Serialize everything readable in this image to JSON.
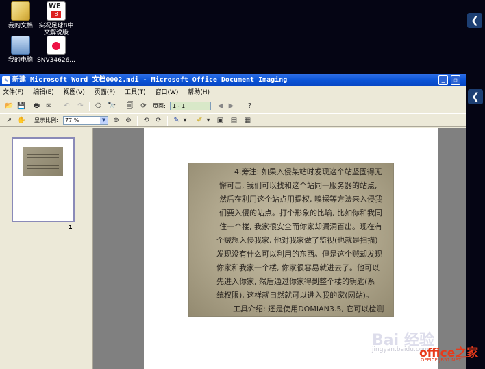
{
  "desktop": {
    "icons": [
      {
        "label": "我的文档",
        "label2": ""
      },
      {
        "label": "实况足球8中",
        "label2": "文解说版"
      },
      {
        "label": "我的电脑",
        "label2": ""
      },
      {
        "label": "SNV34626...",
        "label2": ""
      }
    ],
    "we_badge": "WE",
    "we_badge_num": "8",
    "swift_glyph": "❮"
  },
  "window": {
    "title": "新建 Microsoft Word 文档0002.mdi - Microsoft Office Document Imaging",
    "minimize_glyph": "_",
    "restore_glyph": "❐",
    "menu": [
      "文件(F)",
      "编辑(E)",
      "视图(V)",
      "页面(P)",
      "工具(T)",
      "窗口(W)",
      "帮助(H)"
    ],
    "toolbar1": {
      "page_label": "页面:",
      "page_value": "1 - 1"
    },
    "toolbar2": {
      "zoom_label": "显示比例:",
      "zoom_value": "77 %"
    },
    "thumbnail_page_number": "1"
  },
  "document": {
    "lines": [
      "4.旁注: 如果入侵某站时发现这个站坚固得无",
      "懈可击, 我们可以找和这个站同一服务器的站点,",
      "然后在利用这个站点用提权, 嗅探等方法来入侵我",
      "们要入侵的站点。打个形象的比喻, 比如你和我同",
      "住一个楼, 我家很安全而你家却漏洞百出。现在有",
      "个贼想入侵我家, 他对我家做了监视(也就是扫描)",
      "发现没有什么可以利用的东西。但是这个贼却发现",
      "你家和我家一个楼, 你家很容易就进去了。他可以",
      "先进入你家, 然后通过你家得到整个楼的钥匙(系",
      "统权限), 这样就自然就可以进入我的家(网站)。",
      "工具介绍: 还是使用DOMIAN3.5, 它可以检测"
    ]
  },
  "watermark": {
    "baidu": "Bai 经验",
    "baidu_url": "jingyan.baidu.com",
    "office": "office之家",
    "office_url": "OFFICE.JB51.NET"
  }
}
